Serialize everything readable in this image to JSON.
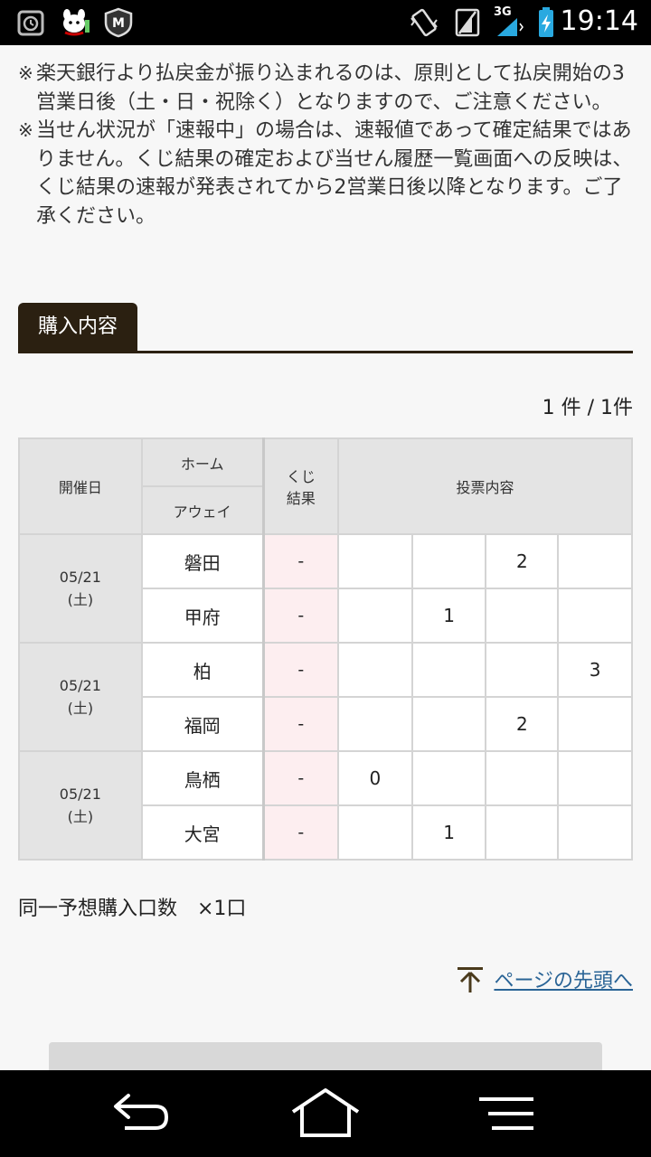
{
  "status_bar": {
    "time": "19:14",
    "network": "3G",
    "icons": [
      "alarm-icon",
      "dog-mascot-icon",
      "shield-m-icon",
      "vibrate-icon",
      "signal-slash-icon",
      "cell-signal-icon",
      "battery-charging-icon"
    ]
  },
  "notes": [
    {
      "mark": "※",
      "text": "楽天銀行より払戻金が振り込まれるのは、原則として払戻開始の3営業日後（土・日・祝除く）となりますので、ご注意ください。"
    },
    {
      "mark": "※",
      "text": "当せん状況が「速報中」の場合は、速報値であって確定結果ではありません。くじ結果の確定および当せん履歴一覧画面への反映は、くじ結果の速報が発表されてから2営業日後以降となります。ご了承ください。"
    }
  ],
  "section_tab": "購入内容",
  "count_text": "1 件 /  1件",
  "table": {
    "headers": {
      "date": "開催日",
      "home": "ホーム",
      "away": "アウェイ",
      "kuji_line1": "くじ",
      "kuji_line2": "結果",
      "vote": "投票内容"
    },
    "matches": [
      {
        "date": "05/21",
        "day": "(土)",
        "home": "磐田",
        "home_kuji": "-",
        "home_votes": [
          "",
          "",
          "2",
          ""
        ],
        "away": "甲府",
        "away_kuji": "-",
        "away_votes": [
          "",
          "1",
          "",
          ""
        ]
      },
      {
        "date": "05/21",
        "day": "(土)",
        "home": "柏",
        "home_kuji": "-",
        "home_votes": [
          "",
          "",
          "",
          "3"
        ],
        "away": "福岡",
        "away_kuji": "-",
        "away_votes": [
          "",
          "",
          "2",
          ""
        ]
      },
      {
        "date": "05/21",
        "day": "(土)",
        "home": "鳥栖",
        "home_kuji": "-",
        "home_votes": [
          "0",
          "",
          "",
          ""
        ],
        "away": "大宮",
        "away_kuji": "-",
        "away_votes": [
          "",
          "1",
          "",
          ""
        ]
      }
    ]
  },
  "quantity_label": "同一予想購入口数　×1口",
  "back_to_top": "ページの先頭へ",
  "colors": {
    "tab_bg": "#2b2011",
    "link": "#2a6496",
    "kuji_bg": "#fdeef0",
    "header_bg": "#e4e4e4"
  },
  "nav": [
    "back-icon",
    "home-icon",
    "menu-icon"
  ]
}
